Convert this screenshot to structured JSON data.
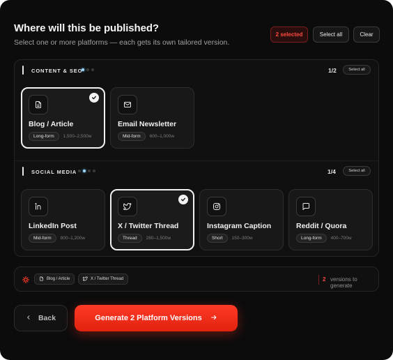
{
  "header": {
    "title": "Where will this be published?",
    "subtitle": "Select one or more platforms — each gets its own tailored version.",
    "selected_badge": "2 selected",
    "select_all": "Select all",
    "clear": "Clear"
  },
  "sections": [
    {
      "title": "CONTENT & SEO",
      "count": "1/2",
      "select_all": "Select all",
      "cards": [
        {
          "name": "Blog / Article",
          "tag": "Long-form",
          "range": "1,500–2,500w",
          "icon": "document-icon",
          "selected": true
        },
        {
          "name": "Email Newsletter",
          "tag": "Mid-form",
          "range": "600–1,000w",
          "icon": "mail-icon",
          "selected": false
        }
      ]
    },
    {
      "title": "SOCIAL MEDIA",
      "count": "1/4",
      "select_all": "Select all",
      "cards": [
        {
          "name": "LinkedIn Post",
          "tag": "Mid-form",
          "range": "800–1,200w",
          "icon": "linkedin-icon",
          "selected": false
        },
        {
          "name": "X / Twitter Thread",
          "tag": "Thread",
          "range": "280–1,500w",
          "icon": "twitter-icon",
          "selected": true
        },
        {
          "name": "Instagram Caption",
          "tag": "Short",
          "range": "150–300w",
          "icon": "instagram-icon",
          "selected": false
        },
        {
          "name": "Reddit / Quora",
          "tag": "Long-form",
          "range": "400–700w",
          "icon": "chat-bubble-icon",
          "selected": false
        }
      ]
    }
  ],
  "summary": {
    "chips": [
      {
        "label": "Blog / Article",
        "icon": "document-icon"
      },
      {
        "label": "X / Twitter Thread",
        "icon": "twitter-icon"
      }
    ],
    "count": "2",
    "label": "versions to generate"
  },
  "actions": {
    "back": "Back",
    "generate": "Generate 2 Platform Versions"
  },
  "colors": {
    "accent": "#ff3a26",
    "background": "#0c0c0c",
    "card": "#181818",
    "selected_border": "#f1f1f1",
    "dot_active": "#9ed8ff"
  }
}
